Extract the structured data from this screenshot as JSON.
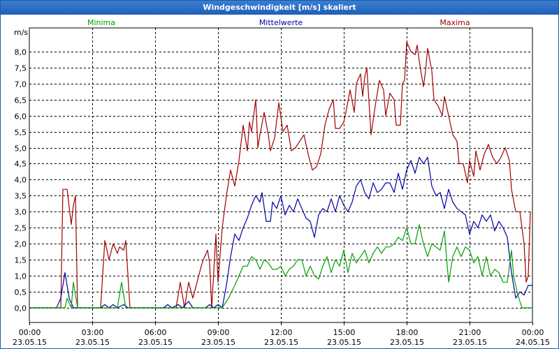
{
  "window": {
    "title": "Windgeschwindigkeit [m/s] skaliert"
  },
  "colors": {
    "minima": "#00a000",
    "mean": "#0000a0",
    "maxima": "#a00000",
    "grid": "#000000",
    "title_bar": "#1e5fb8"
  },
  "chart_data": {
    "type": "line",
    "ylabel": "m/s",
    "ylim": [
      0,
      8.5
    ],
    "y_ticks": [
      "0,0",
      "0,5",
      "1,0",
      "1,5",
      "2,0",
      "2,5",
      "3,0",
      "3,5",
      "4,0",
      "4,5",
      "5,0",
      "5,5",
      "6,0",
      "6,5",
      "7,0",
      "7,5",
      "8,0"
    ],
    "x_ticks": [
      {
        "time": "00:00",
        "date": "23.05.15"
      },
      {
        "time": "03:00",
        "date": "23.05.15"
      },
      {
        "time": "06:00",
        "date": "23.05.15"
      },
      {
        "time": "09:00",
        "date": "23.05.15"
      },
      {
        "time": "12:00",
        "date": "23.05.15"
      },
      {
        "time": "15:00",
        "date": "23.05.15"
      },
      {
        "time": "18:00",
        "date": "23.05.15"
      },
      {
        "time": "21:00",
        "date": "23.05.15"
      },
      {
        "time": "00:00",
        "date": "24.05.15"
      }
    ],
    "xlim_hours": [
      0,
      24
    ],
    "legend": [
      "Minima",
      "Mittelwerte",
      "Maxima"
    ],
    "series": [
      {
        "name": "Maxima",
        "color": "#a00000",
        "points": [
          [
            0,
            0
          ],
          [
            1.5,
            0
          ],
          [
            1.6,
            3.7
          ],
          [
            1.8,
            3.7
          ],
          [
            2.0,
            2.6
          ],
          [
            2.1,
            3.2
          ],
          [
            2.2,
            3.5
          ],
          [
            2.3,
            0
          ],
          [
            3.4,
            0
          ],
          [
            3.6,
            2.1
          ],
          [
            3.8,
            1.5
          ],
          [
            4.0,
            2.0
          ],
          [
            4.2,
            1.7
          ],
          [
            4.3,
            1.9
          ],
          [
            4.5,
            1.8
          ],
          [
            4.6,
            2.1
          ],
          [
            4.8,
            0
          ],
          [
            7.0,
            0
          ],
          [
            7.2,
            0.8
          ],
          [
            7.4,
            0
          ],
          [
            7.6,
            0.8
          ],
          [
            7.8,
            0.3
          ],
          [
            8.0,
            0.8
          ],
          [
            8.2,
            1.3
          ],
          [
            8.3,
            1.5
          ],
          [
            8.5,
            1.8
          ],
          [
            8.6,
            1.4
          ],
          [
            8.7,
            0
          ],
          [
            8.9,
            2.3
          ],
          [
            9.0,
            0.8
          ],
          [
            9.2,
            2.5
          ],
          [
            9.4,
            3.5
          ],
          [
            9.6,
            4.3
          ],
          [
            9.8,
            3.8
          ],
          [
            10.0,
            4.6
          ],
          [
            10.2,
            5.7
          ],
          [
            10.4,
            4.9
          ],
          [
            10.5,
            5.8
          ],
          [
            10.6,
            5.5
          ],
          [
            10.8,
            6.5
          ],
          [
            10.9,
            5.0
          ],
          [
            11.0,
            5.4
          ],
          [
            11.2,
            6.1
          ],
          [
            11.4,
            5.4
          ],
          [
            11.5,
            4.9
          ],
          [
            11.7,
            5.3
          ],
          [
            11.9,
            6.4
          ],
          [
            12.1,
            5.5
          ],
          [
            12.3,
            5.7
          ],
          [
            12.5,
            4.9
          ],
          [
            12.7,
            5.0
          ],
          [
            12.9,
            5.2
          ],
          [
            13.1,
            5.4
          ],
          [
            13.3,
            4.8
          ],
          [
            13.5,
            4.3
          ],
          [
            13.7,
            4.4
          ],
          [
            13.9,
            4.8
          ],
          [
            14.1,
            5.7
          ],
          [
            14.3,
            6.2
          ],
          [
            14.5,
            6.5
          ],
          [
            14.6,
            5.6
          ],
          [
            14.8,
            5.6
          ],
          [
            15.0,
            5.8
          ],
          [
            15.1,
            6.1
          ],
          [
            15.3,
            6.8
          ],
          [
            15.5,
            6.1
          ],
          [
            15.6,
            7.0
          ],
          [
            15.8,
            7.3
          ],
          [
            15.9,
            6.6
          ],
          [
            16.0,
            7.2
          ],
          [
            16.1,
            7.5
          ],
          [
            16.3,
            5.4
          ],
          [
            16.5,
            6.3
          ],
          [
            16.7,
            7.1
          ],
          [
            16.9,
            6.8
          ],
          [
            17.0,
            6.0
          ],
          [
            17.2,
            6.7
          ],
          [
            17.4,
            6.5
          ],
          [
            17.5,
            5.7
          ],
          [
            17.7,
            5.7
          ],
          [
            17.8,
            7.0
          ],
          [
            17.9,
            7.1
          ],
          [
            18.0,
            8.3
          ],
          [
            18.2,
            8.0
          ],
          [
            18.4,
            7.9
          ],
          [
            18.5,
            8.2
          ],
          [
            18.6,
            7.7
          ],
          [
            18.8,
            6.9
          ],
          [
            18.9,
            7.4
          ],
          [
            19.0,
            8.1
          ],
          [
            19.2,
            7.4
          ],
          [
            19.3,
            6.5
          ],
          [
            19.5,
            6.3
          ],
          [
            19.7,
            6.0
          ],
          [
            19.8,
            6.6
          ],
          [
            20.0,
            6.0
          ],
          [
            20.2,
            5.4
          ],
          [
            20.4,
            5.2
          ],
          [
            20.5,
            4.5
          ],
          [
            20.7,
            4.5
          ],
          [
            20.9,
            3.9
          ],
          [
            21.0,
            4.6
          ],
          [
            21.2,
            4.1
          ],
          [
            21.3,
            4.9
          ],
          [
            21.5,
            4.3
          ],
          [
            21.7,
            4.8
          ],
          [
            21.9,
            5.1
          ],
          [
            22.1,
            4.7
          ],
          [
            22.3,
            4.5
          ],
          [
            22.5,
            4.7
          ],
          [
            22.7,
            5.0
          ],
          [
            22.9,
            4.6
          ],
          [
            23.0,
            3.7
          ],
          [
            23.2,
            3.0
          ],
          [
            23.4,
            3.0
          ],
          [
            23.6,
            2.0
          ],
          [
            23.7,
            0.8
          ],
          [
            23.8,
            1.0
          ],
          [
            23.9,
            3.0
          ]
        ]
      },
      {
        "name": "Mittelwerte",
        "color": "#0000a0",
        "points": [
          [
            0,
            0
          ],
          [
            1.3,
            0
          ],
          [
            1.5,
            0.3
          ],
          [
            1.7,
            1.1
          ],
          [
            1.9,
            0.3
          ],
          [
            2.1,
            0.0
          ],
          [
            2.3,
            0.0
          ],
          [
            3.4,
            0
          ],
          [
            3.6,
            0.1
          ],
          [
            3.8,
            0
          ],
          [
            4.0,
            0.1
          ],
          [
            4.2,
            0.0
          ],
          [
            4.5,
            0.1
          ],
          [
            4.7,
            0
          ],
          [
            6.4,
            0
          ],
          [
            6.6,
            0.1
          ],
          [
            6.8,
            0
          ],
          [
            7.1,
            0.1
          ],
          [
            7.3,
            0.0
          ],
          [
            7.6,
            0.2
          ],
          [
            7.8,
            0.0
          ],
          [
            8.4,
            0
          ],
          [
            8.6,
            0.1
          ],
          [
            8.8,
            0.0
          ],
          [
            9.0,
            0.1
          ],
          [
            9.2,
            0.0
          ],
          [
            9.4,
            0.7
          ],
          [
            9.6,
            1.6
          ],
          [
            9.8,
            2.3
          ],
          [
            10.0,
            2.1
          ],
          [
            10.2,
            2.5
          ],
          [
            10.4,
            2.8
          ],
          [
            10.6,
            3.2
          ],
          [
            10.8,
            3.5
          ],
          [
            11.0,
            3.3
          ],
          [
            11.1,
            3.6
          ],
          [
            11.3,
            2.7
          ],
          [
            11.5,
            2.7
          ],
          [
            11.6,
            3.3
          ],
          [
            11.8,
            3.1
          ],
          [
            12.0,
            3.5
          ],
          [
            12.2,
            2.9
          ],
          [
            12.4,
            3.2
          ],
          [
            12.6,
            3.0
          ],
          [
            12.8,
            3.4
          ],
          [
            13.0,
            3.1
          ],
          [
            13.2,
            2.8
          ],
          [
            13.4,
            2.7
          ],
          [
            13.6,
            2.2
          ],
          [
            13.8,
            2.9
          ],
          [
            14.0,
            3.1
          ],
          [
            14.2,
            3.0
          ],
          [
            14.4,
            3.4
          ],
          [
            14.6,
            3.0
          ],
          [
            14.8,
            3.5
          ],
          [
            15.0,
            3.2
          ],
          [
            15.2,
            3.0
          ],
          [
            15.4,
            3.3
          ],
          [
            15.6,
            3.8
          ],
          [
            15.8,
            4.0
          ],
          [
            16.0,
            3.6
          ],
          [
            16.2,
            3.4
          ],
          [
            16.4,
            3.9
          ],
          [
            16.6,
            3.6
          ],
          [
            16.8,
            3.7
          ],
          [
            17.0,
            3.9
          ],
          [
            17.2,
            3.9
          ],
          [
            17.4,
            3.6
          ],
          [
            17.6,
            4.2
          ],
          [
            17.8,
            3.7
          ],
          [
            18.0,
            4.3
          ],
          [
            18.2,
            4.6
          ],
          [
            18.4,
            4.2
          ],
          [
            18.6,
            4.7
          ],
          [
            18.8,
            4.5
          ],
          [
            19.0,
            4.7
          ],
          [
            19.2,
            3.8
          ],
          [
            19.4,
            3.5
          ],
          [
            19.6,
            3.6
          ],
          [
            19.8,
            3.1
          ],
          [
            20.0,
            3.7
          ],
          [
            20.2,
            3.3
          ],
          [
            20.4,
            3.1
          ],
          [
            20.6,
            3.0
          ],
          [
            20.8,
            2.9
          ],
          [
            21.0,
            2.3
          ],
          [
            21.2,
            2.7
          ],
          [
            21.4,
            2.5
          ],
          [
            21.6,
            2.9
          ],
          [
            21.8,
            2.7
          ],
          [
            22.0,
            2.9
          ],
          [
            22.2,
            2.4
          ],
          [
            22.4,
            2.7
          ],
          [
            22.6,
            2.5
          ],
          [
            22.8,
            2.2
          ],
          [
            23.0,
            1.1
          ],
          [
            23.2,
            0.3
          ],
          [
            23.4,
            0.5
          ],
          [
            23.6,
            0.4
          ],
          [
            23.8,
            0.7
          ],
          [
            24.0,
            0.7
          ]
        ]
      },
      {
        "name": "Minima",
        "color": "#00a000",
        "points": [
          [
            0,
            0
          ],
          [
            1.7,
            0
          ],
          [
            1.8,
            0.3
          ],
          [
            2.0,
            0.0
          ],
          [
            2.1,
            0.8
          ],
          [
            2.3,
            0.0
          ],
          [
            4.2,
            0
          ],
          [
            4.4,
            0.8
          ],
          [
            4.6,
            0.0
          ],
          [
            9.2,
            0
          ],
          [
            9.5,
            0.3
          ],
          [
            9.8,
            0.7
          ],
          [
            10.0,
            1.0
          ],
          [
            10.2,
            1.3
          ],
          [
            10.4,
            1.3
          ],
          [
            10.6,
            1.6
          ],
          [
            10.8,
            1.5
          ],
          [
            11.0,
            1.2
          ],
          [
            11.2,
            1.5
          ],
          [
            11.4,
            1.4
          ],
          [
            11.6,
            1.2
          ],
          [
            11.8,
            1.2
          ],
          [
            12.0,
            1.3
          ],
          [
            12.2,
            1.0
          ],
          [
            12.4,
            1.2
          ],
          [
            12.6,
            1.3
          ],
          [
            12.8,
            1.5
          ],
          [
            13.0,
            1.5
          ],
          [
            13.2,
            1.0
          ],
          [
            13.4,
            1.3
          ],
          [
            13.6,
            1.0
          ],
          [
            13.8,
            0.9
          ],
          [
            14.0,
            1.3
          ],
          [
            14.2,
            1.6
          ],
          [
            14.4,
            1.1
          ],
          [
            14.6,
            1.5
          ],
          [
            14.8,
            1.3
          ],
          [
            15.0,
            1.8
          ],
          [
            15.2,
            1.1
          ],
          [
            15.4,
            1.7
          ],
          [
            15.6,
            1.4
          ],
          [
            15.8,
            1.6
          ],
          [
            16.0,
            1.8
          ],
          [
            16.2,
            1.4
          ],
          [
            16.4,
            1.7
          ],
          [
            16.6,
            1.9
          ],
          [
            16.8,
            1.7
          ],
          [
            17.0,
            1.9
          ],
          [
            17.2,
            1.9
          ],
          [
            17.4,
            2.0
          ],
          [
            17.6,
            2.2
          ],
          [
            17.8,
            2.1
          ],
          [
            18.0,
            2.5
          ],
          [
            18.2,
            2.0
          ],
          [
            18.4,
            2.0
          ],
          [
            18.6,
            2.6
          ],
          [
            18.8,
            2.0
          ],
          [
            19.0,
            1.6
          ],
          [
            19.2,
            2.0
          ],
          [
            19.4,
            1.9
          ],
          [
            19.6,
            1.8
          ],
          [
            19.8,
            2.4
          ],
          [
            20.0,
            0.8
          ],
          [
            20.2,
            1.6
          ],
          [
            20.4,
            1.9
          ],
          [
            20.6,
            1.6
          ],
          [
            20.8,
            1.9
          ],
          [
            21.0,
            1.8
          ],
          [
            21.2,
            1.4
          ],
          [
            21.4,
            1.6
          ],
          [
            21.6,
            1.0
          ],
          [
            21.8,
            1.6
          ],
          [
            22.0,
            1.0
          ],
          [
            22.2,
            1.2
          ],
          [
            22.4,
            1.1
          ],
          [
            22.6,
            0.8
          ],
          [
            22.8,
            0.8
          ],
          [
            23.0,
            1.8
          ],
          [
            23.1,
            1.0
          ],
          [
            23.3,
            0.4
          ],
          [
            23.5,
            0.0
          ],
          [
            24.0,
            0
          ]
        ]
      }
    ]
  }
}
